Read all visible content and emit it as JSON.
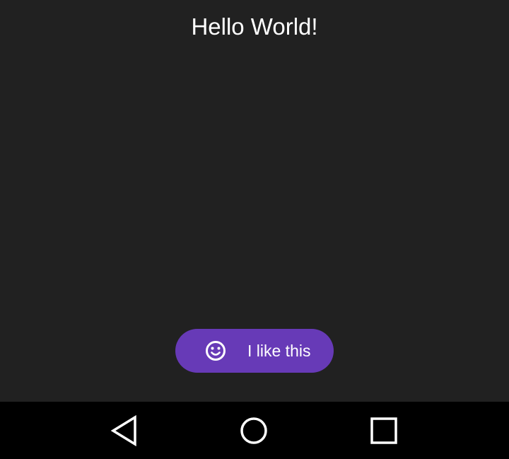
{
  "main": {
    "title": "Hello World!"
  },
  "action_button": {
    "label": "I like this",
    "icon": "smiley-face-icon",
    "background_color": "#673ab7"
  },
  "colors": {
    "content_background": "#212121",
    "navbar_background": "#000000",
    "text": "#ffffff"
  },
  "navbar": {
    "items": [
      {
        "name": "back",
        "icon": "back-triangle-icon"
      },
      {
        "name": "home",
        "icon": "home-circle-icon"
      },
      {
        "name": "recents",
        "icon": "recents-square-icon"
      }
    ]
  }
}
